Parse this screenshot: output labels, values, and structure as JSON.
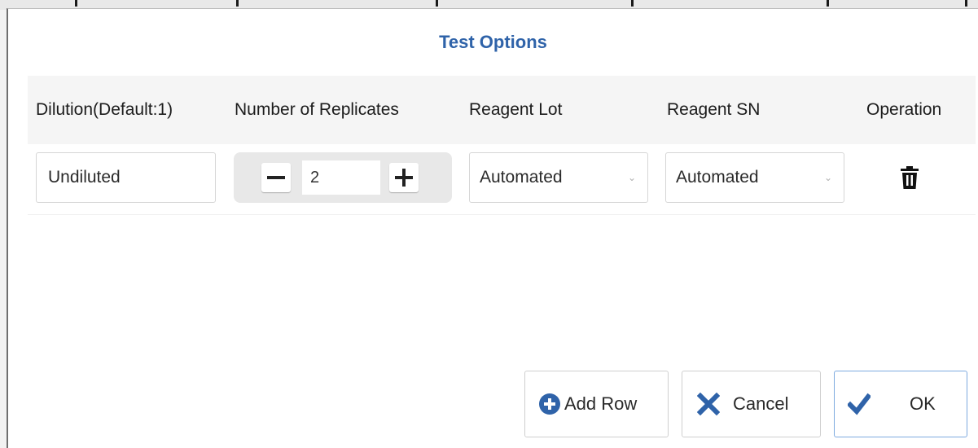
{
  "dialog": {
    "title": "Test Options"
  },
  "columns": [
    {
      "label": "Dilution(Default:1)"
    },
    {
      "label": "Number of Replicates"
    },
    {
      "label": "Reagent Lot"
    },
    {
      "label": "Reagent SN"
    },
    {
      "label": "Operation"
    }
  ],
  "row": {
    "dilution_value": "Undiluted",
    "replicates_value": "2",
    "reagent_lot_value": "Automated",
    "reagent_sn_value": "Automated"
  },
  "footer": {
    "add_row_label": "Add Row",
    "cancel_label": "Cancel",
    "ok_label": "OK"
  },
  "colors": {
    "title": "#2f63a9",
    "add_icon": "#2f63a9",
    "cancel_icon": "#2f63a9",
    "ok_icon": "#2f63a9",
    "ok_border": "#7eaadf",
    "header_bg": "#f5f5f5",
    "stepper_bg": "#e8e8e8"
  },
  "icons": {
    "minus": "minus-icon",
    "plus": "plus-icon",
    "dropdown": "chevron-down-icon",
    "delete": "trash-icon",
    "add": "plus-circle-icon",
    "cancel": "close-icon",
    "ok": "check-icon"
  }
}
